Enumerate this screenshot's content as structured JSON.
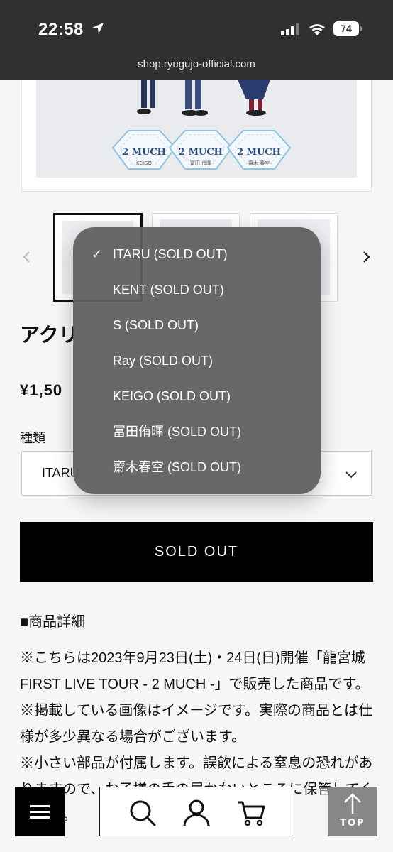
{
  "status_bar": {
    "time": "22:58",
    "battery": "74",
    "url": "shop.ryugujo-official.com"
  },
  "gallery": {
    "main_image_labels": [
      "KEIGO",
      "冨田 侑暉",
      "齋木 春空"
    ]
  },
  "product": {
    "title_visible": "アクリ",
    "price_visible": "¥1,50",
    "kind_label": "種類",
    "selected_value_visible": "ITARU",
    "soldout_label": "SOLD OUT"
  },
  "dropdown": {
    "options": [
      {
        "label": "ITARU (SOLD OUT)",
        "selected": true,
        "check": "✓"
      },
      {
        "label": "KENT (SOLD OUT)",
        "selected": false,
        "check": ""
      },
      {
        "label": "S (SOLD OUT)",
        "selected": false,
        "check": ""
      },
      {
        "label": "Ray (SOLD OUT)",
        "selected": false,
        "check": ""
      },
      {
        "label": "KEIGO (SOLD OUT)",
        "selected": false,
        "check": ""
      },
      {
        "label": "冨田侑暉 (SOLD OUT)",
        "selected": false,
        "check": ""
      },
      {
        "label": "齋木春空 (SOLD OUT)",
        "selected": false,
        "check": ""
      }
    ]
  },
  "details": {
    "heading": "■商品詳細",
    "paragraphs": [
      "※こちらは2023年9月23日(土)・24日(日)開催「龍宮城 FIRST LIVE TOUR - 2 MUCH -」で販売した商品です。",
      "※掲載している画像はイメージです。実際の商品とは仕様が多少異なる場合がございます。",
      "※小さい部品が付属します。誤飲による窒息の恐れがありますので、お子様の手の届かないところに保管してください。"
    ]
  },
  "bottom_nav": {
    "top_label": "TOP"
  },
  "colors": {
    "status_bar_bg": "#2f3030",
    "dropdown_bg": "#5f5f5f",
    "button_bg": "#000000",
    "top_button_bg": "#888888"
  }
}
